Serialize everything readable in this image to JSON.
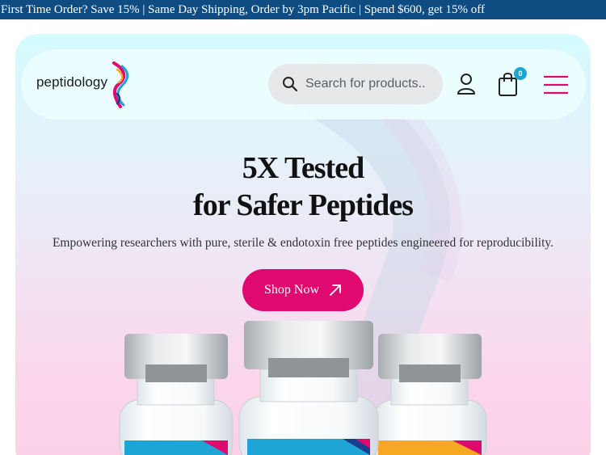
{
  "announcement": {
    "text": "First Time Order? Save 15% | Same Day Shipping, Order by 3pm Pacific | Spend $600, get 15% off"
  },
  "header": {
    "logo_text": "peptidology",
    "search": {
      "placeholder": "Search for products..",
      "value": ""
    },
    "cart": {
      "count": "0"
    },
    "icons": [
      "search-icon",
      "user-icon",
      "cart-icon",
      "menu-icon"
    ]
  },
  "hero": {
    "title_prefix": "5X ",
    "title_bold": "Tested",
    "title_line2": "for Safer Peptides",
    "subtitle": "Empowering researchers with pure, sterile & endotoxin free peptides engineered for reproducibility.",
    "cta_label": "Shop Now",
    "cta_icon": "arrow-up-right-icon"
  },
  "colors": {
    "announcement_bg": "#0f4c81",
    "accent": "#e0096f",
    "cart_badge": "#1ea5d6",
    "vial_label_blue": "#1ea5d6",
    "vial_label_orange": "#f7a823"
  }
}
